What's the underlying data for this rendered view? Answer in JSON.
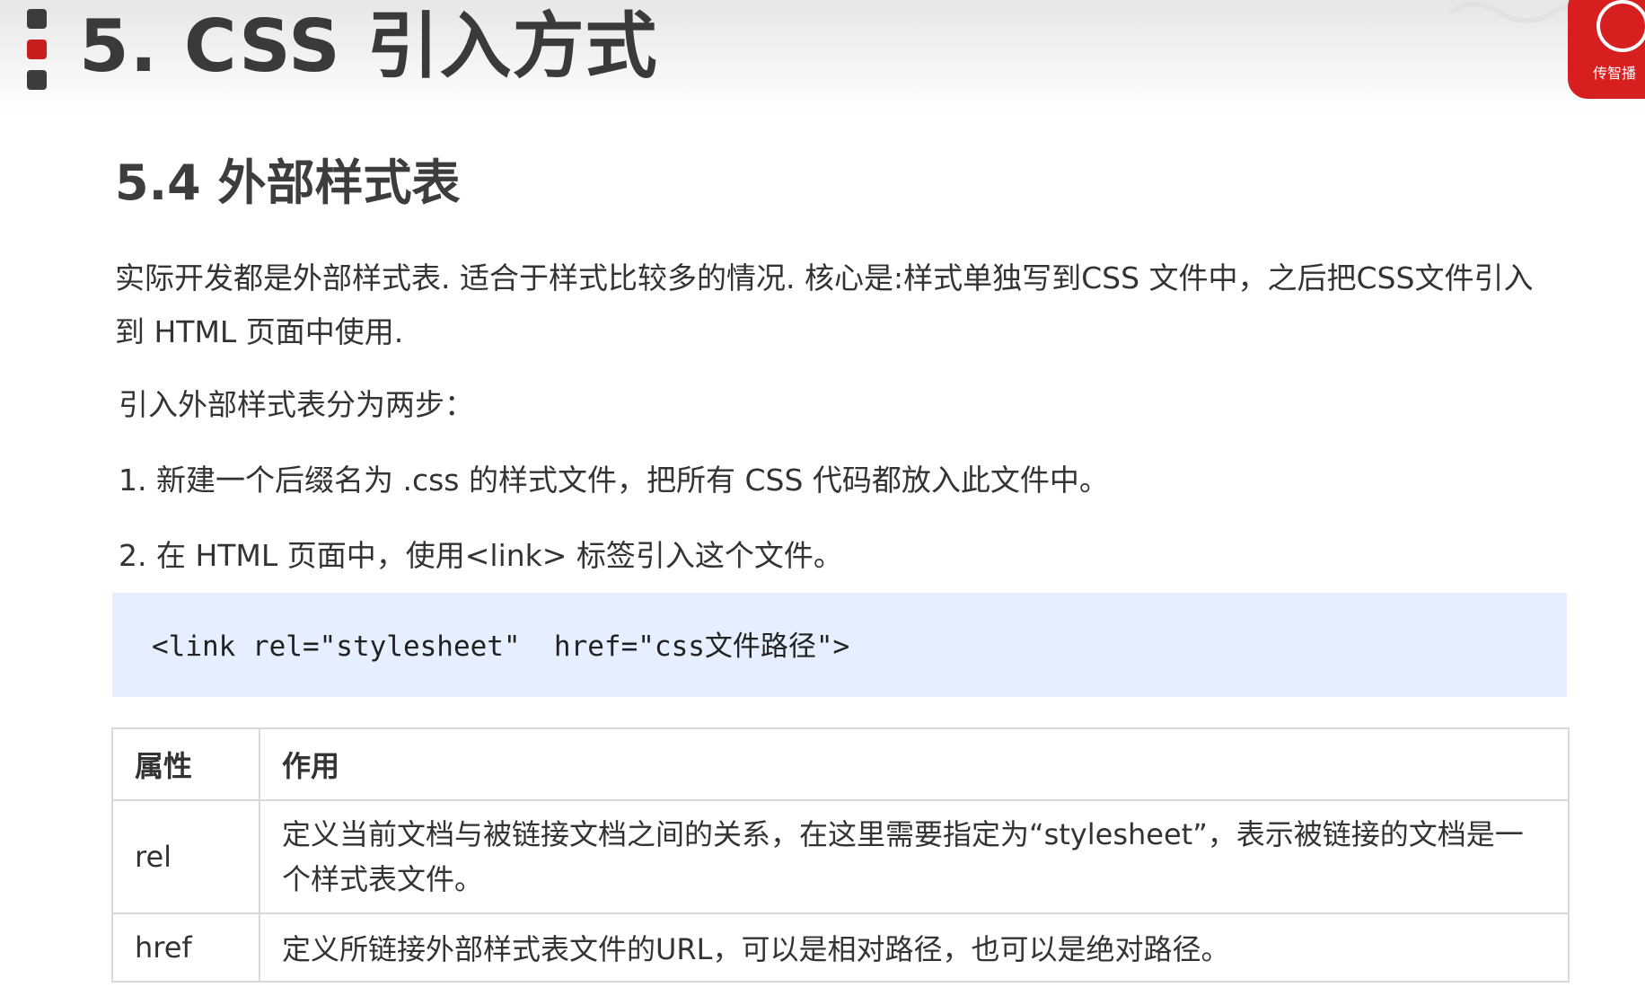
{
  "header": {
    "section_title": "5. CSS 引入方式",
    "logo_text": "传智播"
  },
  "subheading": "5.4 外部样式表",
  "intro_paragraph": "实际开发都是外部样式表. 适合于样式比较多的情况. 核心是:样式单独写到CSS 文件中，之后把CSS文件引入到 HTML 页面中使用.",
  "steps_intro": "引入外部样式表分为两步：",
  "steps": [
    "1. 新建一个后缀名为 .css 的样式文件，把所有 CSS 代码都放入此文件中。",
    "2. 在 HTML 页面中，使用<link> 标签引入这个文件。"
  ],
  "code": "<link rel=\"stylesheet\"  href=\"css文件路径\">",
  "table": {
    "headers": [
      "属性",
      "作用"
    ],
    "rows": [
      [
        "rel",
        "定义当前文档与被链接文档之间的关系，在这里需要指定为“stylesheet”，表示被链接的文档是一个样式表文件。"
      ],
      [
        "href",
        "定义所链接外部样式表文件的URL，可以是相对路径，也可以是绝对路径。"
      ]
    ]
  },
  "colors": {
    "code_background": "#e5efff",
    "marker_red": "#c81e1e",
    "logo_red": "#d71f1f"
  }
}
